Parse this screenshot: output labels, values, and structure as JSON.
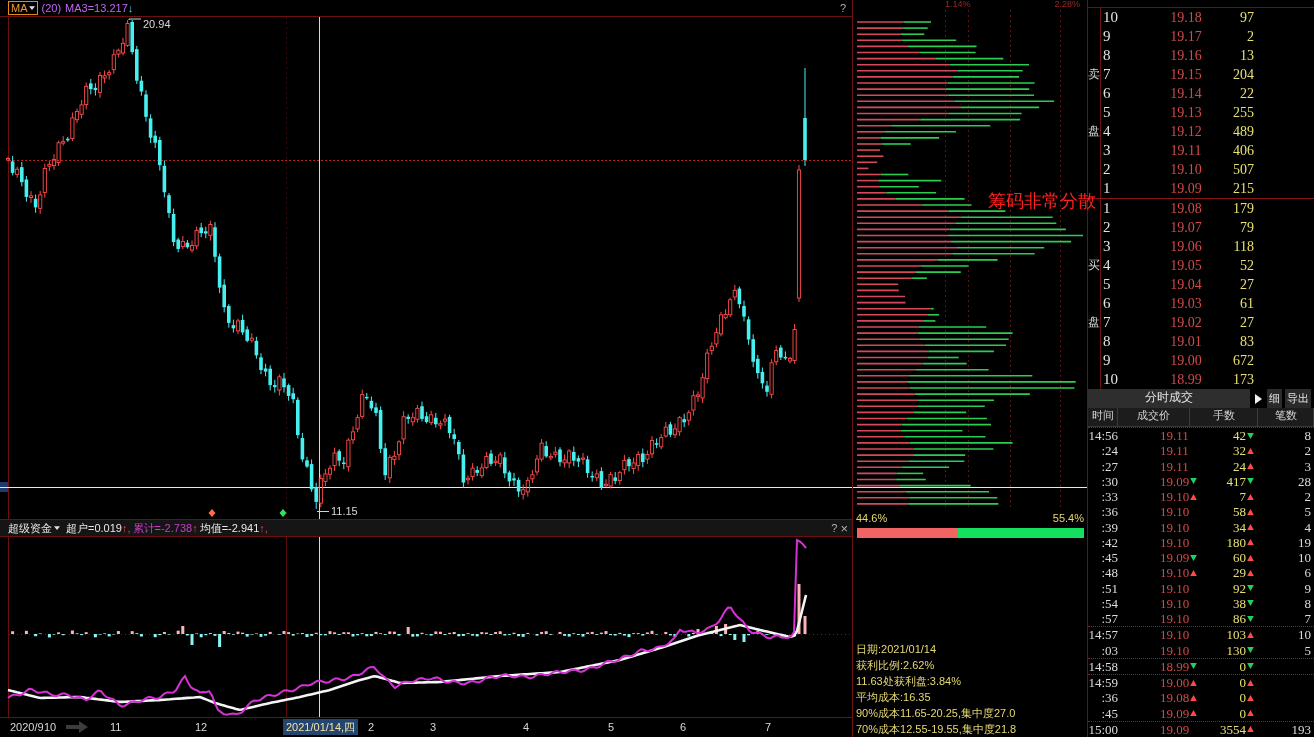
{
  "chart_header": {
    "menu_label": "MA",
    "params": "(20)",
    "ma_value": "MA3=13.217",
    "trend_arrow": "↓",
    "help": "?"
  },
  "main_chart": {
    "high_label": "20.94",
    "low_label": "11.15"
  },
  "indicator": {
    "menu_label": "超级资金",
    "values": [
      {
        "text": "超户=0.019",
        "arrow": "↑,",
        "color": "#e8e8e8"
      },
      {
        "text": "累计=-2.738",
        "arrow": "↑",
        "color": "#c83cc8"
      },
      {
        "text": "均值=-2.941",
        "arrow": "↑,",
        "color": "#e8e8e8"
      }
    ],
    "help": "?",
    "close": "×"
  },
  "x_axis": [
    {
      "text": "2020/9",
      "kind": "tick"
    },
    {
      "text": "10",
      "kind": "tick"
    },
    {
      "text": "11",
      "kind": "tick"
    },
    {
      "text": "12",
      "kind": "tick"
    },
    {
      "text": "2021/01/14,四",
      "kind": "cursor"
    },
    {
      "text": "2",
      "kind": "tick"
    },
    {
      "text": "3",
      "kind": "tick"
    },
    {
      "text": "4",
      "kind": "tick"
    },
    {
      "text": "5",
      "kind": "tick"
    },
    {
      "text": "6",
      "kind": "tick"
    },
    {
      "text": "7",
      "kind": "tick"
    }
  ],
  "chip_panel": {
    "scale_labels": [
      "1.14%",
      "2.28%"
    ],
    "annotation": "筹码非常分散",
    "profit_pct": "44.6%",
    "loss_pct": "55.4%",
    "profit_bar": {
      "level": 0.446
    },
    "info": [
      "日期:2021/01/14",
      "获利比例:2.62%",
      "11.63处获利盘:3.84%",
      "平均成本:16.35",
      "90%成本11.65-20.25,集中度27.0",
      "70%成本12.55-19.55,集中度21.8"
    ]
  },
  "order_book": {
    "sell": [
      {
        "rank": "10",
        "price": "19.18",
        "volume": "97"
      },
      {
        "rank": "9",
        "price": "19.17",
        "volume": "2"
      },
      {
        "rank": "8",
        "price": "19.16",
        "volume": "13"
      },
      {
        "rank": "7",
        "price": "19.15",
        "volume": "204",
        "side": "卖"
      },
      {
        "rank": "6",
        "price": "19.14",
        "volume": "22"
      },
      {
        "rank": "5",
        "price": "19.13",
        "volume": "255"
      },
      {
        "rank": "4",
        "price": "19.12",
        "volume": "489",
        "side": "盘"
      },
      {
        "rank": "3",
        "price": "19.11",
        "volume": "406"
      },
      {
        "rank": "2",
        "price": "19.10",
        "volume": "507"
      },
      {
        "rank": "1",
        "price": "19.09",
        "volume": "215"
      }
    ],
    "buy": [
      {
        "rank": "1",
        "price": "19.08",
        "volume": "179"
      },
      {
        "rank": "2",
        "price": "19.07",
        "volume": "79"
      },
      {
        "rank": "3",
        "price": "19.06",
        "volume": "118"
      },
      {
        "rank": "4",
        "price": "19.05",
        "volume": "52",
        "side": "买"
      },
      {
        "rank": "5",
        "price": "19.04",
        "volume": "27"
      },
      {
        "rank": "6",
        "price": "19.03",
        "volume": "61"
      },
      {
        "rank": "7",
        "price": "19.02",
        "volume": "27",
        "side": "盘"
      },
      {
        "rank": "8",
        "price": "19.01",
        "volume": "83"
      },
      {
        "rank": "9",
        "price": "19.00",
        "volume": "672"
      },
      {
        "rank": "10",
        "price": "18.99",
        "volume": "173"
      }
    ]
  },
  "trades_panel": {
    "title": "分时成交",
    "detail_button": "细",
    "export_button": "导出",
    "columns": [
      "时间",
      "成交价",
      "手数",
      "笔数"
    ],
    "rows": [
      {
        "time": "14:56",
        "price": "19.11",
        "volume": "42",
        "vol_up": false,
        "count": "8",
        "minute_start": true
      },
      {
        "time": ":24",
        "price": "19.11",
        "volume": "32",
        "vol_up": true,
        "count": "2",
        "minute_start": false
      },
      {
        "time": ":27",
        "price": "19.11",
        "volume": "24",
        "vol_up": true,
        "count": "3",
        "minute_start": false
      },
      {
        "time": ":30",
        "price": "19.09",
        "price_up": false,
        "volume": "417",
        "vol_up": false,
        "count": "28",
        "minute_start": false
      },
      {
        "time": ":33",
        "price": "19.10",
        "price_up": true,
        "volume": "7",
        "vol_up": true,
        "count": "2",
        "minute_start": false
      },
      {
        "time": ":36",
        "price": "19.10",
        "volume": "58",
        "vol_up": true,
        "count": "5",
        "minute_start": false
      },
      {
        "time": ":39",
        "price": "19.10",
        "volume": "34",
        "vol_up": true,
        "count": "4",
        "minute_start": false
      },
      {
        "time": ":42",
        "price": "19.10",
        "volume": "180",
        "vol_up": true,
        "count": "19",
        "minute_start": false
      },
      {
        "time": ":45",
        "price": "19.09",
        "price_up": false,
        "volume": "60",
        "vol_up": true,
        "count": "10",
        "minute_start": false
      },
      {
        "time": ":48",
        "price": "19.10",
        "price_up": true,
        "volume": "29",
        "vol_up": true,
        "count": "6",
        "minute_start": false
      },
      {
        "time": ":51",
        "price": "19.10",
        "volume": "92",
        "vol_up": false,
        "count": "9",
        "minute_start": false
      },
      {
        "time": ":54",
        "price": "19.10",
        "volume": "38",
        "vol_up": false,
        "count": "8",
        "minute_start": false
      },
      {
        "time": ":57",
        "price": "19.10",
        "volume": "86",
        "vol_up": false,
        "count": "7",
        "minute_start": false
      },
      {
        "time": "14:57",
        "price": "19.10",
        "volume": "103",
        "vol_up": true,
        "count": "10",
        "minute_start": true
      },
      {
        "time": ":03",
        "price": "19.10",
        "volume": "130",
        "vol_up": false,
        "count": "5",
        "minute_start": false
      },
      {
        "time": "14:58",
        "price": "18.99",
        "price_up": false,
        "volume": "0",
        "vol_up": false,
        "minute_start": true
      },
      {
        "time": "14:59",
        "price": "19.00",
        "price_up": true,
        "volume": "0",
        "vol_up": true,
        "minute_start": true
      },
      {
        "time": ":36",
        "price": "19.08",
        "price_up": true,
        "volume": "0",
        "vol_up": true,
        "minute_start": false
      },
      {
        "time": ":45",
        "price": "19.09",
        "price_up": true,
        "volume": "0",
        "vol_up": true,
        "minute_start": false
      },
      {
        "time": "15:00",
        "price": "19.09",
        "volume": "3554",
        "vol_up": true,
        "count": "193",
        "minute_start": true
      }
    ]
  }
}
